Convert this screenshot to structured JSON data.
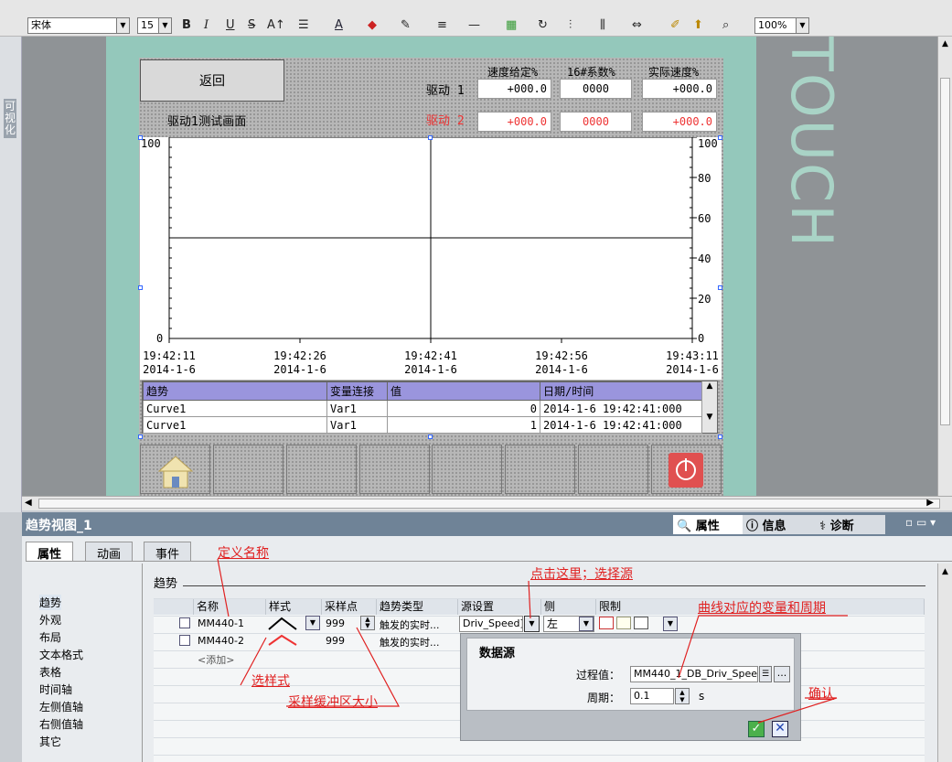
{
  "toolbar": {
    "font": "宋体",
    "size": "15",
    "zoom": "100%",
    "bold": "B",
    "italic": "I",
    "underline": "U",
    "strike": "S"
  },
  "sidebar": {
    "label": "可视化"
  },
  "hmi": {
    "back_button": "返回",
    "screen_title": "驱动1测试画面",
    "col_speed_set": "速度给定%",
    "col_coef": "16#系数%",
    "col_actual": "实际速度%",
    "drive1_label": "驱动 1",
    "drive2_label": "驱动 2",
    "drive1_values": [
      "+000.0",
      "0000",
      "+000.0"
    ],
    "drive2_values": [
      "+000.0",
      "0000",
      "+000.0"
    ],
    "watermark": "TOUCH"
  },
  "chart_data": {
    "type": "line",
    "left_axis": {
      "top": "100",
      "bottom": "0"
    },
    "right_ticks": [
      "100",
      "80",
      "60",
      "40",
      "20",
      "0"
    ],
    "x_ticks": [
      {
        "time": "19:42:11",
        "date": "2014-1-6"
      },
      {
        "time": "19:42:26",
        "date": "2014-1-6"
      },
      {
        "time": "19:42:41",
        "date": "2014-1-6"
      },
      {
        "time": "19:42:56",
        "date": "2014-1-6"
      },
      {
        "time": "19:43:11",
        "date": "2014-1-6"
      }
    ],
    "ylim": [
      0,
      100
    ]
  },
  "trend_table": {
    "headers": [
      "趋势",
      "变量连接",
      "值",
      "日期/时间"
    ],
    "rows": [
      [
        "Curve1",
        "Var1",
        "0",
        "2014-1-6 19:42:41:000"
      ],
      [
        "Curve1",
        "Var1",
        "1",
        "2014-1-6 19:42:41:000"
      ]
    ]
  },
  "inspector": {
    "object_name": "趋势视图_1",
    "right_tabs": [
      "属性",
      "信息",
      "诊断"
    ],
    "tabs": [
      "属性",
      "动画",
      "事件"
    ],
    "side_items": [
      "趋势",
      "外观",
      "布局",
      "文本格式",
      "表格",
      "时间轴",
      "左侧值轴",
      "右侧值轴",
      "其它"
    ],
    "section_title": "趋势",
    "grid_headers": [
      "名称",
      "样式",
      "采样点",
      "趋势类型",
      "源设置",
      "侧",
      "限制"
    ],
    "rows": [
      {
        "name": "MM440-1",
        "samples": "999",
        "type": "触发的实时...",
        "source": "Driv_Speed]",
        "side": "左"
      },
      {
        "name": "MM440-2",
        "samples": "999",
        "type": "触发的实时...",
        "source": "",
        "side": ""
      }
    ],
    "add_row": "<添加>"
  },
  "popup": {
    "title": "数据源",
    "process_label": "过程值：",
    "process_value": "MM440_1_DB_Driv_Spee",
    "period_label": "周期：",
    "period_value": "0.1",
    "period_unit": "s"
  },
  "annotations": {
    "name": "定义名称",
    "source": "点击这里；选择源",
    "variable": "曲线对应的变量和周期",
    "style": "选样式",
    "buffer": "采样缓冲区大小",
    "confirm": "确认"
  },
  "colors": {
    "panel": "#94c8bb",
    "header_blue": "#9a95dd",
    "annotation": "#e02020",
    "drive2": "#e33"
  }
}
